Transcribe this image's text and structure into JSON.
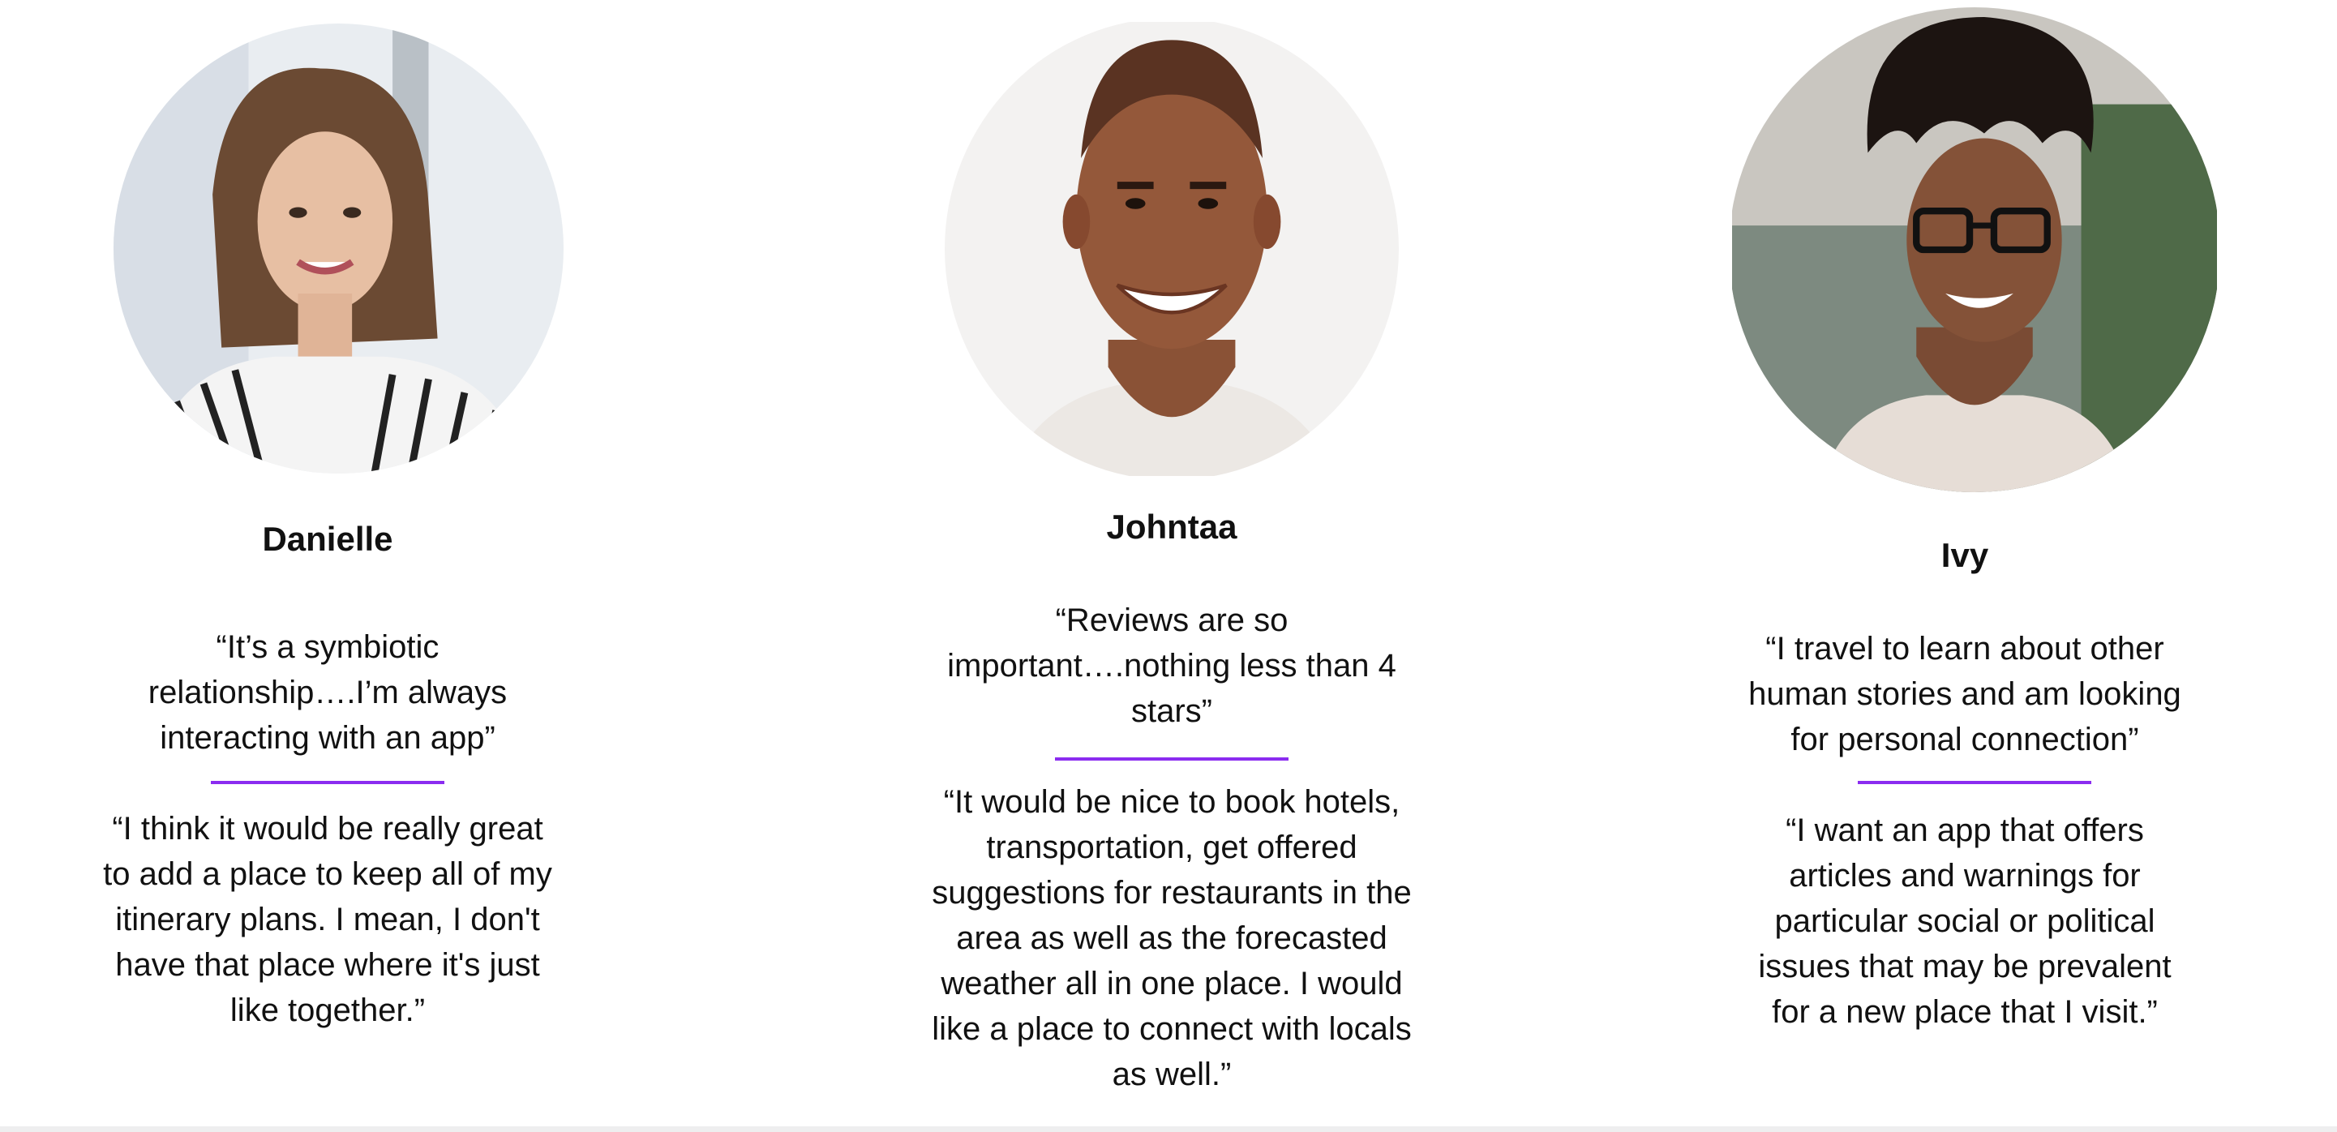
{
  "accent_color": "#8b2cf0",
  "personas": [
    {
      "name": "Danielle",
      "avatar_icon": "portrait-woman-striped-shirt",
      "quote1": [
        "“It’s a symbiotic",
        "relationship….I’m always",
        "interacting with an app”"
      ],
      "quote2": [
        "“I think it would be really great",
        "to add a place to keep all of my",
        "itinerary plans. I mean, I don't",
        "have that place where it's just",
        "like together.”"
      ]
    },
    {
      "name": "Johntaa",
      "avatar_icon": "portrait-man-smiling",
      "quote1": [
        "“Reviews are so",
        "important….nothing less than 4",
        "stars”"
      ],
      "quote2": [
        "“It would be nice to book hotels,",
        "transportation, get offered",
        "suggestions for restaurants in the",
        "area as well as the forecasted",
        "weather all in one place. I would",
        "like a place to connect with locals",
        "as well.”"
      ]
    },
    {
      "name": "Ivy",
      "avatar_icon": "portrait-woman-glasses",
      "quote1": [
        "“I travel to learn about other",
        "human stories and am looking",
        "for personal connection”"
      ],
      "quote2": [
        "“I want an app that offers",
        "articles and warnings for",
        "particular social or political",
        "issues that may be prevalent",
        "for a new place that I visit.”"
      ]
    }
  ]
}
